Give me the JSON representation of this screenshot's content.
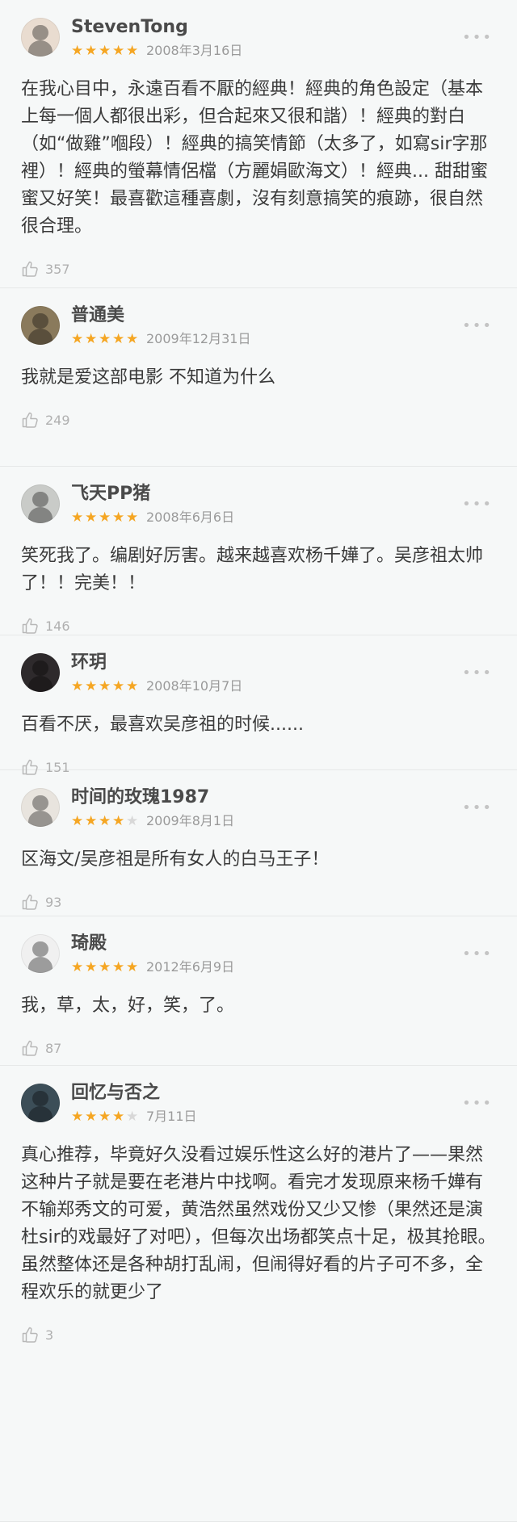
{
  "colors": {
    "star": "#f5a623",
    "star_empty": "#d8d8d8",
    "background": "#f6f8f8"
  },
  "reviews": [
    {
      "user": "StevenTong",
      "stars": 5,
      "date": "2008年3月16日",
      "text": "在我心目中，永遠百看不厭的經典！經典的角色設定（基本上每一個人都很出彩，但合起來又很和諧）！經典的對白（如“做雞”嗰段）！經典的搞笑情節（太多了，如寫sir字那裡）！經典的螢幕情侶檔（方麗娟歐海文）！經典... 甜甜蜜蜜又好笑！最喜歡這種喜劇，沒有刻意搞笑的痕跡，很自然很合理。",
      "likes": "357",
      "more": "•••",
      "avatar_color": "#e9dcd0"
    },
    {
      "user": "普通美",
      "stars": 5,
      "date": "2009年12月31日",
      "text": "我就是爱这部电影 不知道为什么",
      "likes": "249",
      "more": "•••",
      "avatar_color": "#8a7a5c"
    },
    {
      "user": "飞天PP猪",
      "stars": 5,
      "date": "2008年6月6日",
      "text": "笑死我了。编剧好厉害。越来越喜欢杨千嬅了。吴彦祖太帅了！！完美！！",
      "likes": "146",
      "more": "•••",
      "avatar_color": "#c9cbc8"
    },
    {
      "user": "环玥",
      "stars": 5,
      "date": "2008年10月7日",
      "text": "百看不厌，最喜欢吴彦祖的时候......",
      "likes": "151",
      "more": "•••",
      "avatar_color": "#2e2a2c"
    },
    {
      "user": "时间的玫瑰1987",
      "stars": 4,
      "date": "2009年8月1日",
      "text": "区海文/吴彦祖是所有女人的白马王子！",
      "likes": "93",
      "more": "•••",
      "avatar_color": "#e8e4de"
    },
    {
      "user": "琦殿",
      "stars": 5,
      "date": "2012年6月9日",
      "text": "我，草，太，好，笑，了。",
      "likes": "87",
      "more": "•••",
      "avatar_color": "#f0f0f0"
    },
    {
      "user": "回忆与否之",
      "stars": 4,
      "date": "7月11日",
      "text": "真心推荐，毕竟好久没看过娱乐性这么好的港片了——果然这种片子就是要在老港片中找啊。看完才发现原来杨千嬅有不输郑秀文的可爱，黄浩然虽然戏份又少又惨（果然还是演杜sir的戏最好了对吧），但每次出场都笑点十足，极其抢眼。虽然整体还是各种胡打乱闹，但闹得好看的片子可不多，全程欢乐的就更少了",
      "likes": "3",
      "more": "•••",
      "avatar_color": "#3c4e58"
    }
  ]
}
